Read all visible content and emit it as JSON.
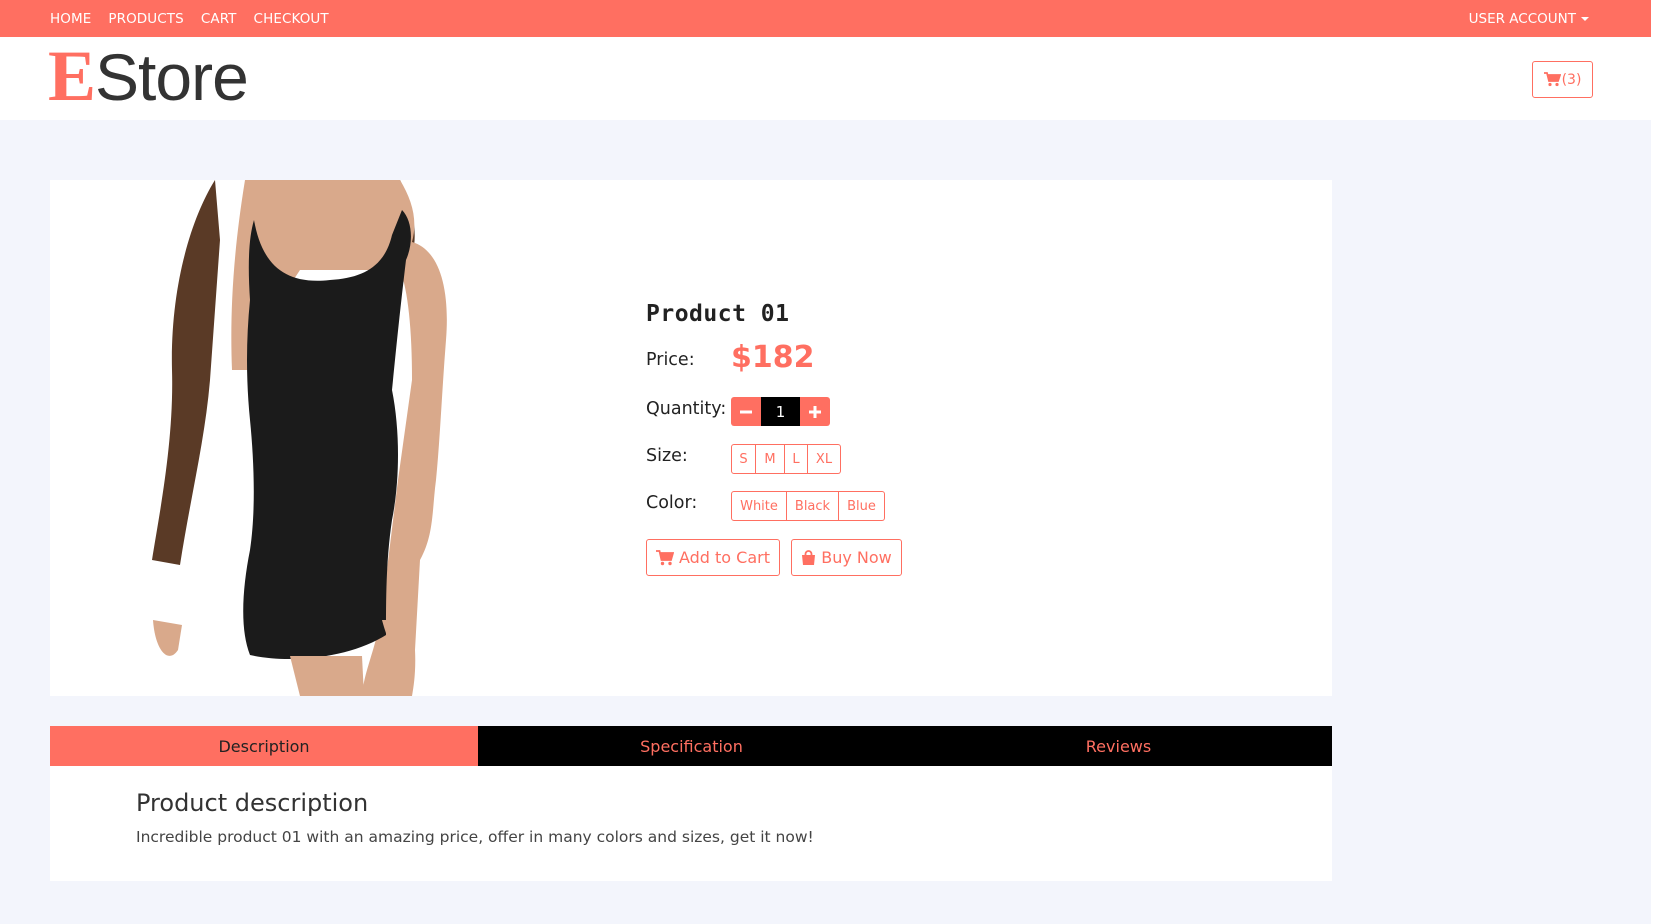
{
  "topnav": {
    "items": [
      "HOME",
      "PRODUCTS",
      "CART",
      "CHECKOUT"
    ],
    "account_label": "USER ACCOUNT"
  },
  "header": {
    "logo_first": "E",
    "logo_rest": "Store",
    "cart_count": "(3)"
  },
  "product": {
    "name": "Product 01",
    "price_label": "Price:",
    "price": "$182",
    "quantity_label": "Quantity:",
    "quantity": "1",
    "size_label": "Size:",
    "sizes": [
      "S",
      "M",
      "L",
      "XL"
    ],
    "color_label": "Color:",
    "colors": [
      "White",
      "Black",
      "Blue"
    ],
    "add_to_cart": "Add to Cart",
    "buy_now": "Buy Now",
    "image_icon": "model-in-black-dress-photo"
  },
  "tabs": {
    "items": [
      "Description",
      "Specification",
      "Reviews"
    ],
    "active": "Description"
  },
  "description": {
    "title": "Product description",
    "text": "Incredible product 01 with an amazing price, offer in many colors and sizes, get it now!"
  },
  "colors": {
    "accent": "#ff6f61",
    "page_bg": "#f3f5fc",
    "tab_inactive_bg": "#000000"
  }
}
